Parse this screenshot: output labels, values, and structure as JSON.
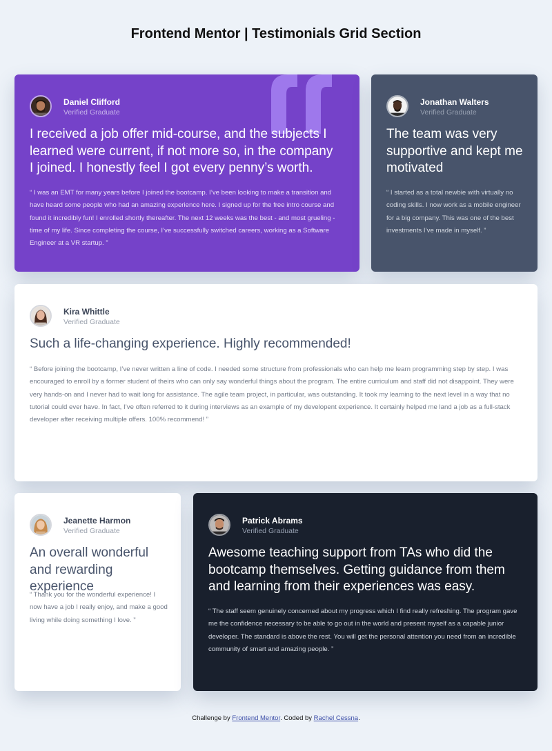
{
  "page_title": "Frontend Mentor | Testimonials Grid Section",
  "colors": {
    "background": "#edf2f8",
    "purple": "#7542c9",
    "slate": "#48546b",
    "white": "#ffffff",
    "dark": "#19202d"
  },
  "testimonials": [
    {
      "name": "Daniel Clifford",
      "role": "Verified Graduate",
      "headline": "I received a job offer mid-course, and the subjects I learned were current, if not more so, in the company I joined. I honestly feel I got every penny’s worth.",
      "body": "“ I was an EMT for many years before I joined the bootcamp. I’ve been looking to make a transition and have heard some people who had an amazing experience here. I signed up for the free intro course and found it incredibly fun! I enrolled shortly thereafter. The next 12 weeks was the best - and most grueling - time of my life. Since completing the course, I’ve successfully switched careers, working as a Software Engineer at a VR startup. ”"
    },
    {
      "name": "Jonathan Walters",
      "role": "Verified Graduate",
      "headline": "The team was very supportive and kept me motivated",
      "body": "“ I started as a total newbie with virtually no coding skills. I now work as a mobile engineer for a big company. This was one of the best investments I’ve made in myself. ”"
    },
    {
      "name": "Kira Whittle",
      "role": "Verified Graduate",
      "headline": "Such a life-changing experience. Highly recommended!",
      "body": "“ Before joining the bootcamp, I’ve never written a line of code. I needed some structure from professionals who can help me learn programming step by step. I was encouraged to enroll by a former student of theirs who can only say wonderful things about the program. The entire curriculum and staff did not disappoint. They were very hands-on and I never had to wait long for assistance. The agile team project, in particular, was outstanding. It took my learning to the next level in a way that no tutorial could ever have. In fact, I’ve often referred to it during interviews as an example of my developent experience. It certainly helped me land a job as a full-stack developer after receiving multiple offers. 100% recommend! ”"
    },
    {
      "name": "Jeanette Harmon",
      "role": "Verified Graduate",
      "headline": "An overall wonderful and rewarding experience",
      "body": "“ Thank you for the wonderful experience! I now have a job I really enjoy, and make a good living while doing something I love. ”"
    },
    {
      "name": "Patrick Abrams",
      "role": "Verified Graduate",
      "headline": "Awesome teaching support from TAs who did the bootcamp themselves. Getting guidance from them and learning from their experiences was easy.",
      "body": "“ The staff seem genuinely concerned about my progress which I find really refreshing. The program gave me the confidence necessary to be able to go out in the world and present myself as a capable junior developer. The standard is above the rest. You will get the personal attention you need from an incredible community of smart and amazing people. ”"
    }
  ],
  "footer": {
    "prefix": "Challenge by ",
    "link1": "Frontend Mentor",
    "middle": ". Coded by ",
    "link2": "Rachel Cessna",
    "suffix": "."
  }
}
